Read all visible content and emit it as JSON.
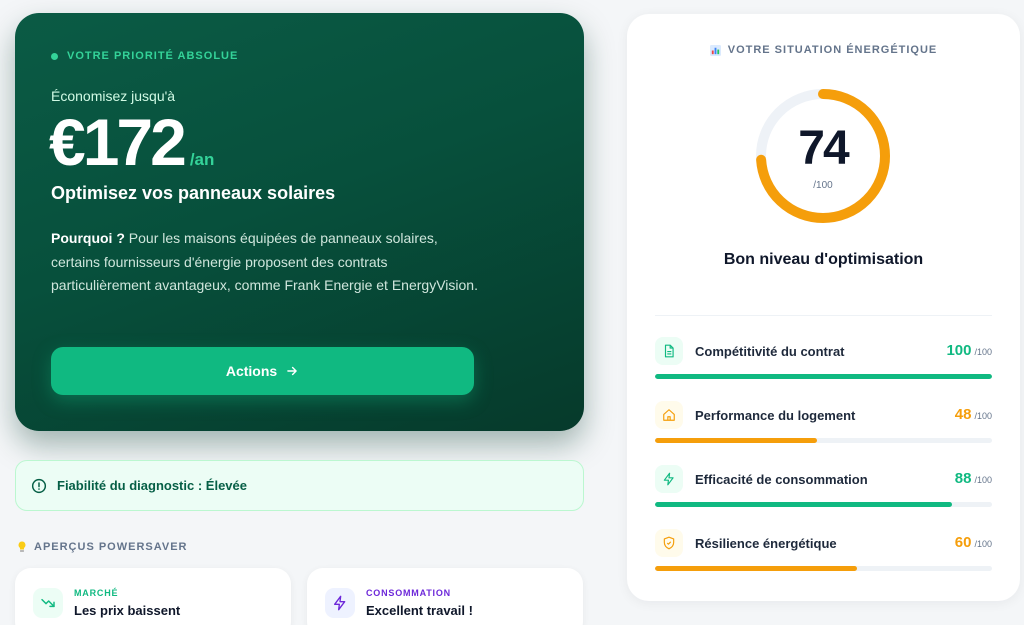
{
  "hero": {
    "eyebrow": "VOTRE PRIORITÉ ABSOLUE",
    "save_label": "Économisez jusqu'à",
    "amount": "€172",
    "per": "/an",
    "headline": "Optimisez vos panneaux solaires",
    "why_label": "Pourquoi ?",
    "body": "Pour les maisons équipées de panneaux solaires, certains fournisseurs d'énergie proposent des contrats particulièrement avantageux, comme Frank Energie et EnergyVision.",
    "actions_label": "Actions",
    "accent": "#10b981"
  },
  "reliability": {
    "label": "Fiabilité du diagnostic : Élevée"
  },
  "insights": {
    "title": "APERÇUS POWERSAVER",
    "cards": [
      {
        "category": "MARCHÉ",
        "title": "Les prix baissent",
        "icon": "trending-down-icon",
        "color": "#10b981"
      },
      {
        "category": "CONSOMMATION",
        "title": "Excellent travail !",
        "icon": "bolt-icon",
        "color": "#6d28d9"
      }
    ]
  },
  "panel": {
    "title": "VOTRE SITUATION ÉNERGÉTIQUE",
    "score": "74",
    "score_max": "/100",
    "score_fraction": 0.74,
    "level": "Bon niveau d'optimisation",
    "metrics": [
      {
        "label": "Compétitivité du contrat",
        "value": "100",
        "max": "/100",
        "fraction": 1.0,
        "color": "#10b981",
        "icon": "document-icon"
      },
      {
        "label": "Performance du logement",
        "value": "48",
        "max": "/100",
        "fraction": 0.48,
        "color": "#f59e0b",
        "icon": "home-icon"
      },
      {
        "label": "Efficacité de consommation",
        "value": "88",
        "max": "/100",
        "fraction": 0.88,
        "color": "#10b981",
        "icon": "bolt-icon"
      },
      {
        "label": "Résilience énergétique",
        "value": "60",
        "max": "/100",
        "fraction": 0.6,
        "color": "#f59e0b",
        "icon": "shield-icon"
      }
    ]
  }
}
